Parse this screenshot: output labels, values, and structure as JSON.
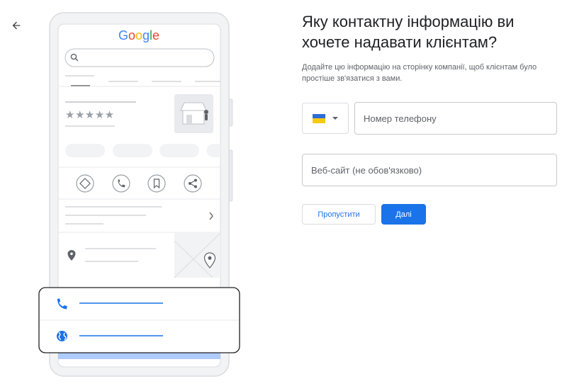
{
  "illustration": {
    "brand_logo": "Google"
  },
  "form": {
    "heading": "Яку контактну інформацію ви хочете надавати клієнтам?",
    "description": "Додайте цю інформацію на сторінку компанії, щоб клієнтам було простіше зв'язатися з вами.",
    "country_flag": "ukraine-flag",
    "phone_placeholder": "Номер телефону",
    "website_placeholder": "Веб-сайт (не обов'язково)"
  },
  "actions": {
    "skip_label": "Пропустити",
    "next_label": "Далі"
  },
  "colors": {
    "accent": "#1a73e8",
    "flag_blue": "#2f6dd5",
    "flag_yellow": "#f7c917"
  }
}
